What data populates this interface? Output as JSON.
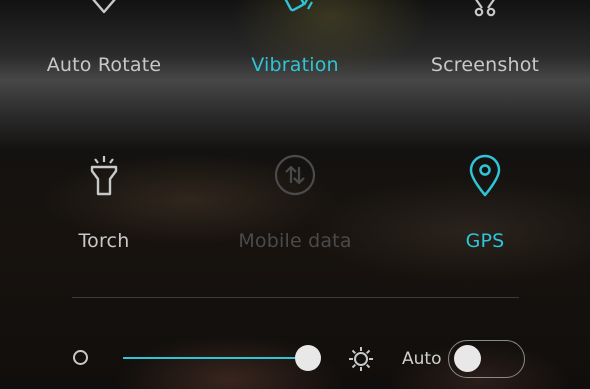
{
  "quick_settings": {
    "tiles": [
      {
        "label": "Auto Rotate",
        "icon": "auto-rotate-icon",
        "state": "off"
      },
      {
        "label": "Vibration",
        "icon": "vibration-icon",
        "state": "on"
      },
      {
        "label": "Screenshot",
        "icon": "screenshot-icon",
        "state": "off"
      },
      {
        "label": "Torch",
        "icon": "torch-icon",
        "state": "off"
      },
      {
        "label": "Mobile data",
        "icon": "mobile-data-icon",
        "state": "disabled"
      },
      {
        "label": "GPS",
        "icon": "gps-icon",
        "state": "on"
      }
    ]
  },
  "brightness": {
    "min_icon": "brightness-low-icon",
    "max_icon": "brightness-high-icon",
    "level": 1.0,
    "auto_label": "Auto",
    "auto_enabled": false
  },
  "colors": {
    "accent": "#2fc4d6",
    "inactive_text": "#c8c8c8",
    "disabled_text": "#4a4a4a"
  }
}
